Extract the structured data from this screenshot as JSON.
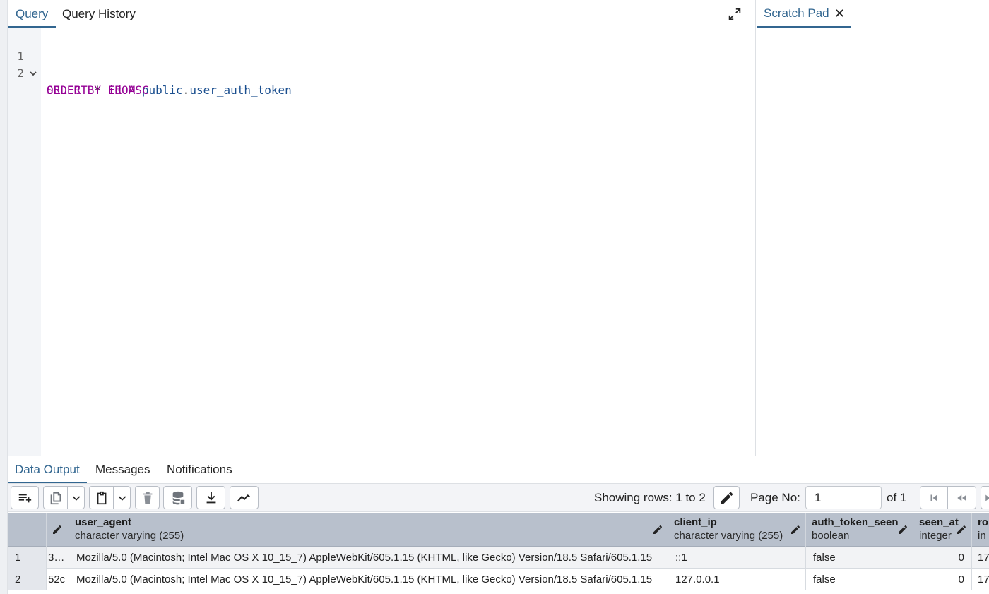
{
  "query_tabs": [
    {
      "label": "Query"
    },
    {
      "label": "Query History"
    }
  ],
  "scratch": {
    "label": "Scratch Pad"
  },
  "editor": {
    "line_numbers": [
      "1",
      "2"
    ],
    "line1": {
      "kw1": "SELECT",
      "op": " * ",
      "kw2": "FROM",
      "schema": "public",
      "dot": ".",
      "table": "user_auth_token"
    },
    "line2": {
      "kw1": "ORDER BY",
      "ident": "id",
      "kw2": "ASC"
    }
  },
  "result_tabs": [
    {
      "label": "Data Output"
    },
    {
      "label": "Messages"
    },
    {
      "label": "Notifications"
    }
  ],
  "toolbar": {
    "rows_label": "Showing rows: 1 to 2",
    "page_label": "Page No:",
    "page_value": "1",
    "of_label": "of 1"
  },
  "columns": [
    {
      "name": "user_agent",
      "type": "character varying (255)"
    },
    {
      "name": "client_ip",
      "type": "character varying (255)"
    },
    {
      "name": "auth_token_seen",
      "type": "boolean"
    },
    {
      "name": "seen_at",
      "type": "integer"
    },
    {
      "name": "ro",
      "type": "in"
    }
  ],
  "rows": [
    {
      "num": "1",
      "prev": "3…",
      "user_agent": "Mozilla/5.0 (Macintosh; Intel Mac OS X 10_15_7) AppleWebKit/605.1.15 (KHTML, like Gecko) Version/18.5 Safari/605.1.15",
      "client_ip": "::1",
      "auth_token_seen": "false",
      "seen_at": "0",
      "ro": "17"
    },
    {
      "num": "2",
      "prev": "52c",
      "user_agent": "Mozilla/5.0 (Macintosh; Intel Mac OS X 10_15_7) AppleWebKit/605.1.15 (KHTML, like Gecko) Version/18.5 Safari/605.1.15",
      "client_ip": "127.0.0.1",
      "auth_token_seen": "false",
      "seen_at": "0",
      "ro": "17"
    }
  ],
  "colors": {
    "accent": "#326690",
    "keyword": "#950095",
    "identifier": "#1b4f8f",
    "header_bg": "#b8c0cc"
  }
}
